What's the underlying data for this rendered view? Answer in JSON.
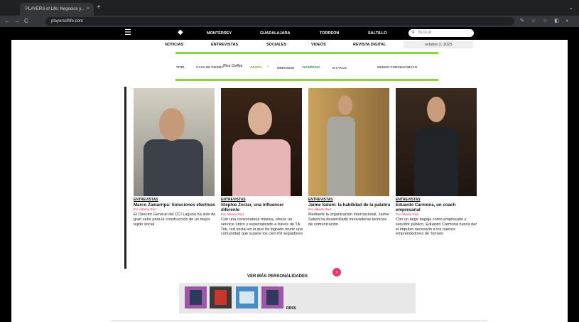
{
  "browser": {
    "tab_title": "PLAYERS of Life: Negocios y...",
    "tab_close": "×",
    "new_tab": "+",
    "url": "playersoflife.com",
    "window_controls": "⌄",
    "nav_back": "←",
    "nav_forward": "→",
    "nav_reload": "C",
    "extensions": "✎ ☆ ☆ ◧ ◐"
  },
  "site": {
    "cities": [
      "MONTERREY",
      "GUADALAJARA",
      "TORREÓN",
      "SALTILLO"
    ],
    "search_placeholder": "Buscar",
    "subnav": [
      "NOTICIAS",
      "ENTREVISTAS",
      "SOCIALES",
      "VIDEOS",
      "REVISTA DIGITAL"
    ],
    "date": "octubre 2, 2023"
  },
  "sponsors": [
    "VITEL",
    "CASA DE PIEDRA",
    "Rice Coffee",
    "AGORA",
    "○",
    "MINHOUSE",
    "NVOROGIA",
    "B-CYCLE",
    "MUNDO CORONA",
    "CIMACO"
  ],
  "articles": [
    {
      "category": "ENTREVISTAS",
      "title": "Marco Zamarripa: Soluciones efectivas",
      "author": "Por Alberto Ruiz",
      "summary": "El Director General del CCI Laguna ha sido de gran valor para la construcción de un mejor tejido social"
    },
    {
      "category": "ENTREVISTAS",
      "title": "Stephie Zorzar, una influencer diferente",
      "author": "Por Alberto Ruiz",
      "summary": "Con una convocatoria masiva, ofrece un servicio único y especializado a través de Tik Tok, red social en la que ha logrado reunir una comunidad que supera los cien mil seguidores"
    },
    {
      "category": "ENTREVISTAS",
      "title": "Jaime Salum: la habilidad de la palabra",
      "author": "Por Alberto Ruiz",
      "summary": "Mediante la organización internacional, Jaime Salum ha desarrollado innovadoras técnicas de comunicación"
    },
    {
      "category": "ENTREVISTAS",
      "title": "Eduardo Carmona, un coach empresarial",
      "author": "Por Alberto Ruiz",
      "summary": "Con un largo bagaje como empresario y servidor público, Eduardo Carmona busca dar el impulso necesario a los nuevos emprendedores de Torreón"
    }
  ],
  "more_button": "VER MÁS PERSONALIDADES",
  "more_arrow": "›",
  "ad_label": "RRSS",
  "colors": {
    "accent_green": "#8bd53a",
    "accent_pink": "#e83a6a"
  }
}
